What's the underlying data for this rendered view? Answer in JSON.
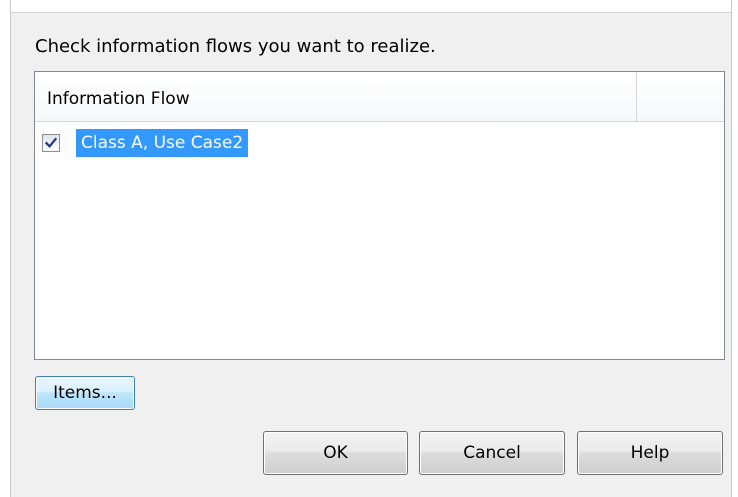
{
  "instruction": "Check information flows you want to realize.",
  "list": {
    "columns": [
      "Information Flow",
      ""
    ],
    "rows": [
      {
        "label": "Class A, Use Case2",
        "checked": true,
        "selected": true
      }
    ]
  },
  "buttons": {
    "items": "Items...",
    "ok": "OK",
    "cancel": "Cancel",
    "help": "Help"
  },
  "colors": {
    "selection": "#3399ff",
    "dialog_background": "#f0f0f0"
  }
}
